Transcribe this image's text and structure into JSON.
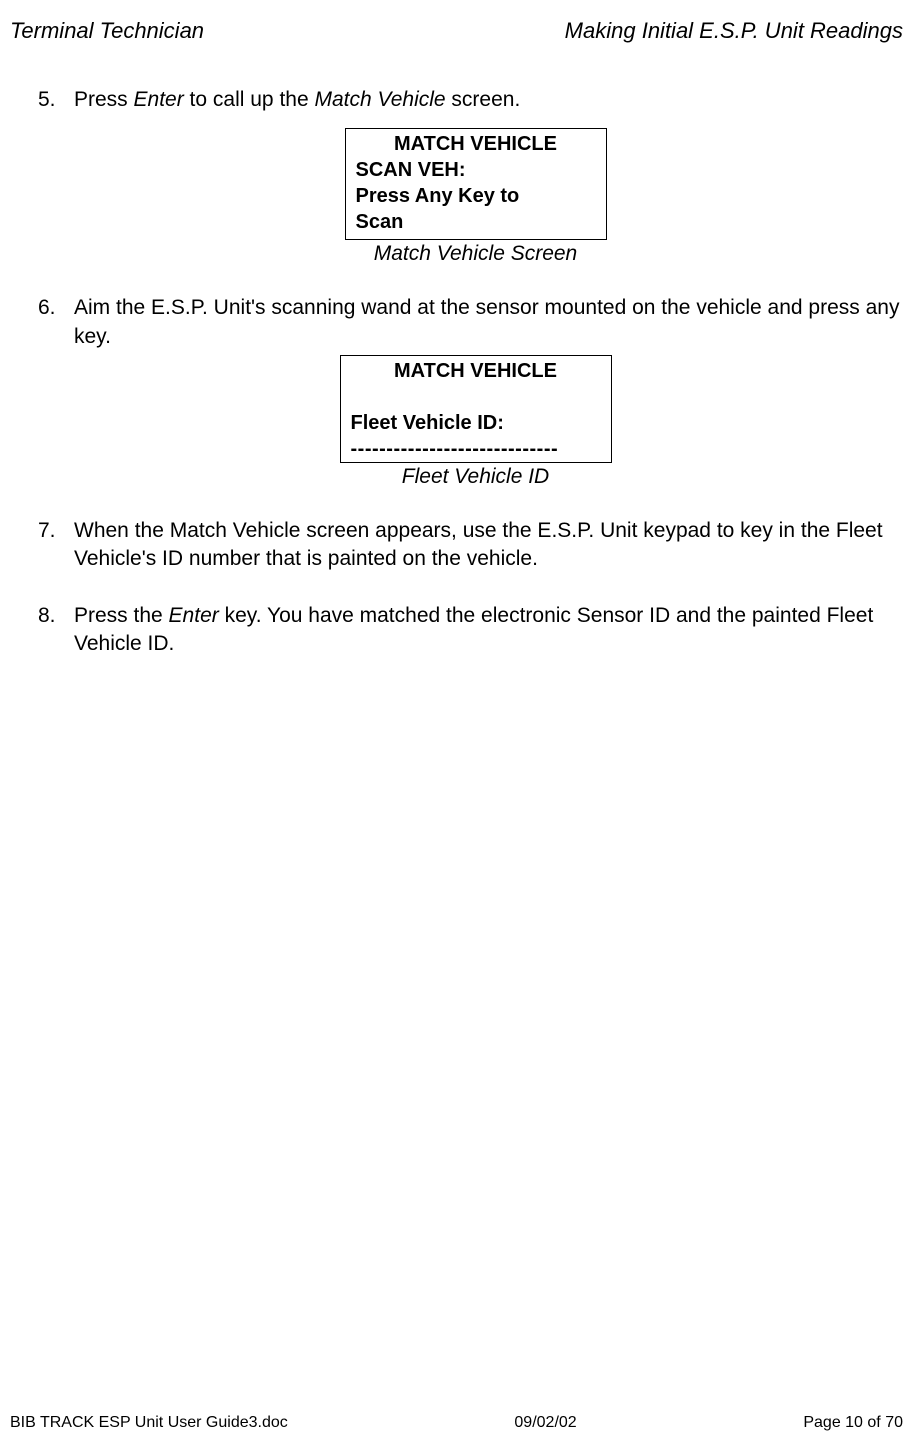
{
  "header": {
    "left": "Terminal Technician",
    "right": "Making Initial E.S.P. Unit Readings"
  },
  "steps": {
    "s5": {
      "n": "5.",
      "t1": "Press ",
      "t2": "Enter",
      "t3": " to call up the ",
      "t4": "Match Vehicle",
      "t5": " screen."
    },
    "s6": {
      "n": "6.",
      "t": "Aim the E.S.P. Unit's scanning wand at the sensor mounted on the vehicle and press any key."
    },
    "s7": {
      "n": "7.",
      "t": "When the Match Vehicle screen appears, use the E.S.P. Unit keypad to key in the Fleet Vehicle's ID number that is painted on the vehicle."
    },
    "s8": {
      "n": "8.",
      "t1": "Press the ",
      "t2": "Enter",
      "t3": " key.  You have matched the electronic Sensor ID and the painted Fleet Vehicle ID."
    }
  },
  "screen1": {
    "title": "MATCH VEHICLE",
    "line1": "SCAN VEH:",
    "line2": "Press Any Key to",
    "line3": "Scan",
    "caption": "Match Vehicle Screen"
  },
  "screen2": {
    "title": "MATCH VEHICLE",
    "blank": " ",
    "line1": "Fleet Vehicle ID:",
    "line2": "-----------------------------",
    "caption": "Fleet Vehicle ID"
  },
  "footer": {
    "left": "BIB TRACK  ESP Unit User Guide3.doc",
    "mid": "09/02/02",
    "right": "Page 10 of 70"
  }
}
